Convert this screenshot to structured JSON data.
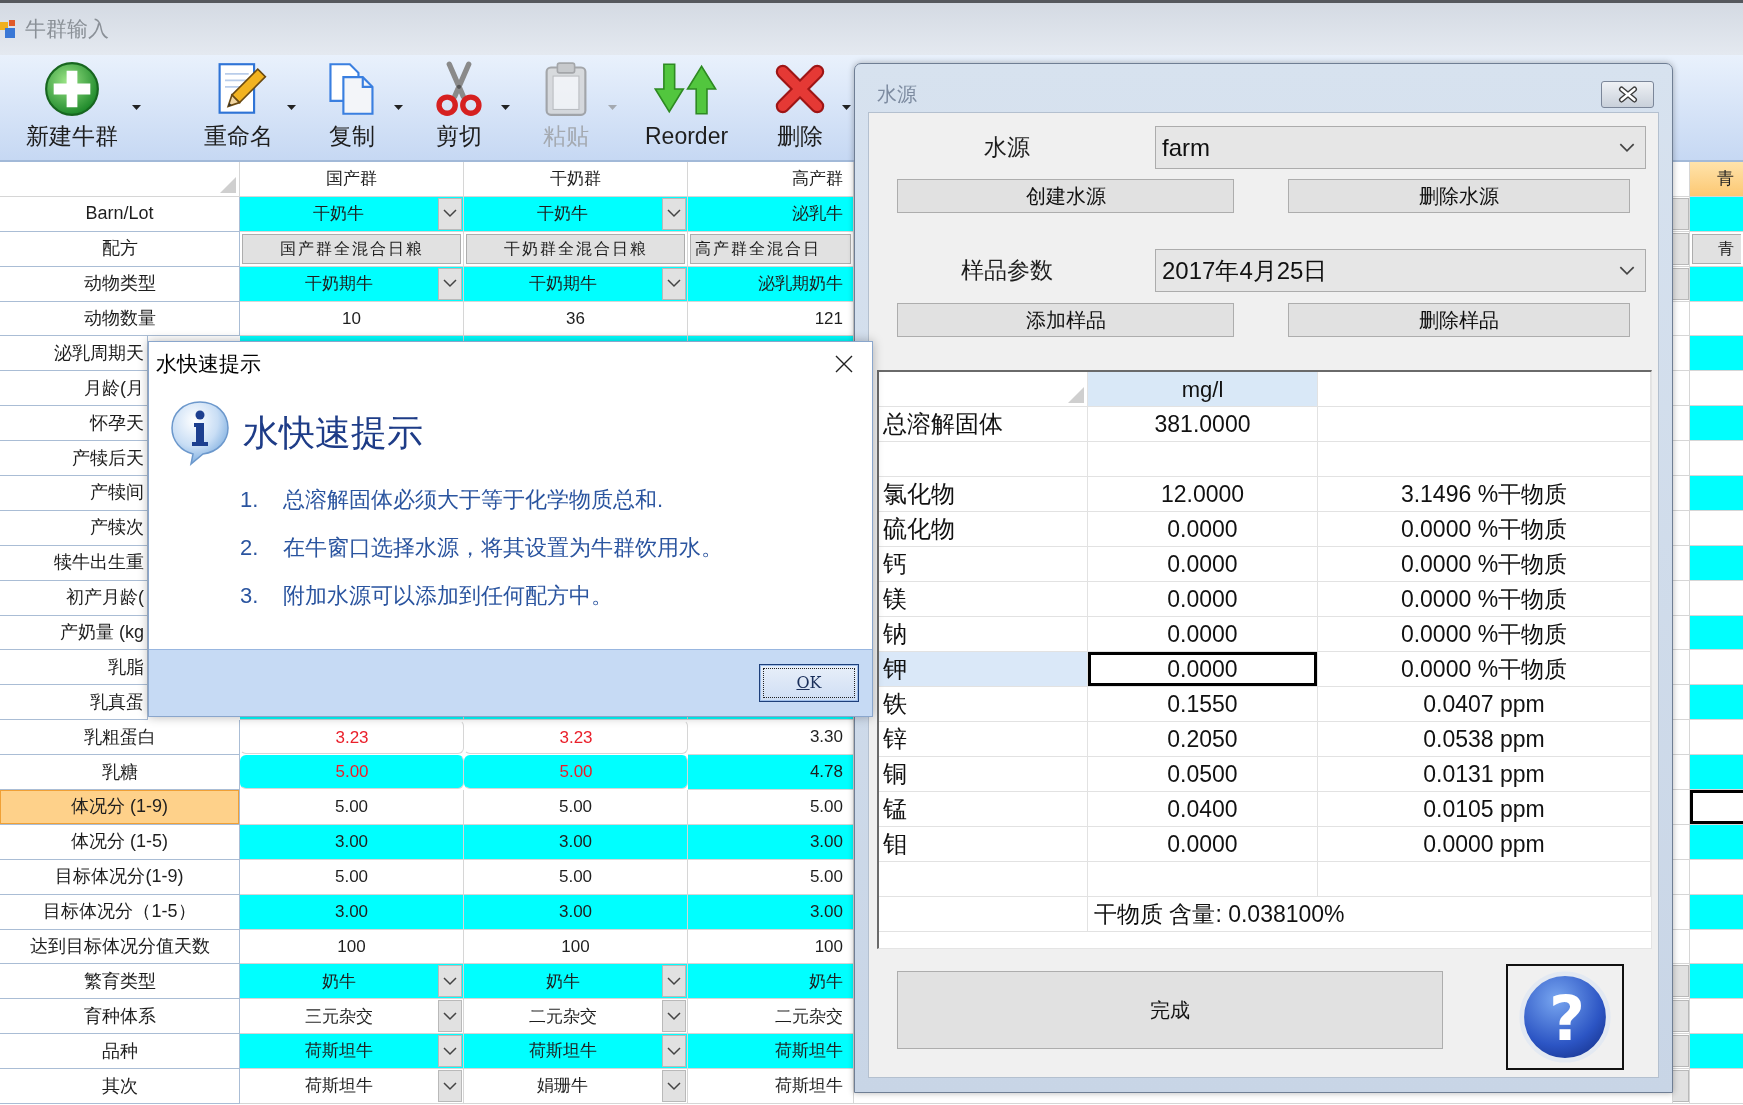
{
  "window": {
    "title": "牛群输入"
  },
  "toolbar": [
    {
      "label": "新建牛群",
      "kind": "add",
      "menu": true,
      "disabled": false
    },
    {
      "label": "重命名",
      "kind": "rename",
      "menu": true,
      "disabled": false
    },
    {
      "label": "复制",
      "kind": "copy",
      "menu": true,
      "disabled": false
    },
    {
      "label": "剪切",
      "kind": "cut",
      "menu": true,
      "disabled": false
    },
    {
      "label": "粘贴",
      "kind": "paste",
      "menu": true,
      "disabled": true
    },
    {
      "label": "Reorder",
      "kind": "reorder",
      "menu": false,
      "disabled": false
    },
    {
      "label": "删除",
      "kind": "delete",
      "menu": true,
      "disabled": false
    }
  ],
  "grid": {
    "columns": [
      {
        "header": "国产群",
        "kind": "full",
        "selected": false
      },
      {
        "header": "干奶群",
        "kind": "full",
        "selected": false
      },
      {
        "header": "高产群",
        "kind": "covered",
        "selected": false
      },
      {
        "header": "青",
        "kind": "edge",
        "selected": true
      }
    ],
    "rows": [
      {
        "label": "Barn/Lot",
        "kind": "combo",
        "highlighted": true,
        "selected": false,
        "cells": [
          {
            "text": "干奶牛"
          },
          {
            "text": "干奶牛"
          },
          {
            "text": "泌乳牛"
          }
        ]
      },
      {
        "label": "配方",
        "kind": "button",
        "highlighted": false,
        "selected": false,
        "cells": [
          {
            "text": "国产群全混合日粮"
          },
          {
            "text": "干奶群全混合日粮"
          },
          {
            "text": "高产群全混合日"
          },
          {
            "text": "青"
          }
        ]
      },
      {
        "label": "动物类型",
        "kind": "combo",
        "highlighted": true,
        "selected": false,
        "cells": [
          {
            "text": "干奶期牛"
          },
          {
            "text": "干奶期牛"
          },
          {
            "text": "泌乳期奶牛"
          }
        ]
      },
      {
        "label": "动物数量",
        "kind": "text",
        "highlighted": false,
        "selected": false,
        "cells": [
          {
            "text": "10"
          },
          {
            "text": "36"
          },
          {
            "text": "121"
          }
        ]
      },
      {
        "label": "泌乳周期天",
        "kind": "text",
        "highlighted": true,
        "selected": false
      },
      {
        "label": "月龄(月",
        "kind": "text",
        "highlighted": false,
        "selected": false
      },
      {
        "label": "怀孕天",
        "kind": "text",
        "highlighted": true,
        "selected": false
      },
      {
        "label": "产犊后天",
        "kind": "text",
        "highlighted": false,
        "selected": false
      },
      {
        "label": "产犊间",
        "kind": "text",
        "highlighted": true,
        "selected": false
      },
      {
        "label": "产犊次",
        "kind": "text",
        "highlighted": false,
        "selected": false
      },
      {
        "label": "犊牛出生重",
        "kind": "text",
        "highlighted": true,
        "selected": false
      },
      {
        "label": "初产月龄(",
        "kind": "text",
        "highlighted": false,
        "selected": false
      },
      {
        "label": "产奶量 (kg",
        "kind": "text",
        "highlighted": true,
        "selected": false
      },
      {
        "label": "乳脂",
        "kind": "text",
        "highlighted": false,
        "selected": false
      },
      {
        "label": "乳真蛋",
        "kind": "text",
        "highlighted": true,
        "selected": false
      },
      {
        "label": "乳粗蛋白",
        "kind": "text",
        "highlighted": false,
        "selected": false,
        "cells": [
          {
            "text": "3.23",
            "alert": true
          },
          {
            "text": "3.23",
            "alert": true
          },
          {
            "text": "3.30",
            "alert": false
          }
        ]
      },
      {
        "label": "乳糖",
        "kind": "text",
        "highlighted": true,
        "selected": false,
        "cells": [
          {
            "text": "5.00",
            "alert": true
          },
          {
            "text": "5.00",
            "alert": true
          },
          {
            "text": "4.78",
            "alert": false
          }
        ]
      },
      {
        "label": "体况分 (1-9)",
        "kind": "text",
        "highlighted": false,
        "selected": true,
        "cells": [
          {
            "text": "5.00"
          },
          {
            "text": "5.00"
          },
          {
            "text": "5.00"
          }
        ]
      },
      {
        "label": "体况分 (1-5)",
        "kind": "text",
        "highlighted": true,
        "selected": false,
        "cells": [
          {
            "text": "3.00"
          },
          {
            "text": "3.00"
          },
          {
            "text": "3.00"
          }
        ]
      },
      {
        "label": "目标体况分(1-9)",
        "kind": "text",
        "highlighted": false,
        "selected": false,
        "cells": [
          {
            "text": "5.00"
          },
          {
            "text": "5.00"
          },
          {
            "text": "5.00"
          }
        ]
      },
      {
        "label": "目标体况分（1-5）",
        "kind": "text",
        "highlighted": true,
        "selected": false,
        "cells": [
          {
            "text": "3.00"
          },
          {
            "text": "3.00"
          },
          {
            "text": "3.00"
          }
        ]
      },
      {
        "label": "达到目标体况分值天数",
        "kind": "text",
        "highlighted": false,
        "selected": false,
        "cells": [
          {
            "text": "100"
          },
          {
            "text": "100"
          },
          {
            "text": "100"
          }
        ]
      },
      {
        "label": "繁育类型",
        "kind": "combo",
        "highlighted": true,
        "selected": false,
        "cells": [
          {
            "text": "奶牛"
          },
          {
            "text": "奶牛"
          },
          {
            "text": "奶牛"
          }
        ]
      },
      {
        "label": "育种体系",
        "kind": "combo",
        "highlighted": false,
        "selected": false,
        "cells": [
          {
            "text": "三元杂交"
          },
          {
            "text": "二元杂交"
          },
          {
            "text": "二元杂交"
          }
        ]
      },
      {
        "label": "品种",
        "kind": "combo",
        "highlighted": true,
        "selected": false,
        "cells": [
          {
            "text": "荷斯坦牛"
          },
          {
            "text": "荷斯坦牛"
          },
          {
            "text": "荷斯坦牛"
          }
        ]
      },
      {
        "label": "其次",
        "kind": "combo",
        "highlighted": false,
        "selected": false,
        "cells": [
          {
            "text": "荷斯坦牛"
          },
          {
            "text": "娟珊牛"
          },
          {
            "text": "荷斯坦牛"
          }
        ]
      }
    ]
  },
  "water_dialog": {
    "title": "水源",
    "source": {
      "label": "水源",
      "value": "farm"
    },
    "source_buttons": [
      "创建水源",
      "删除水源"
    ],
    "sample": {
      "label": "样品参数",
      "value": "2017年4月25日"
    },
    "sample_buttons": [
      "添加样品",
      "删除样品"
    ],
    "table": {
      "columns": [
        {
          "header": "mg/l",
          "selected": true
        },
        {
          "selected": false
        }
      ],
      "rows": [
        {
          "kind": "data",
          "label": "总溶解固体",
          "value": "381.0000",
          "selected": false
        },
        {
          "kind": "blank",
          "selected": false
        },
        {
          "kind": "data",
          "label": "氯化物",
          "value": "12.0000",
          "share": "3.1496 %干物质",
          "selected": false
        },
        {
          "kind": "data",
          "label": "硫化物",
          "value": "0.0000",
          "share": "0.0000 %干物质",
          "selected": false
        },
        {
          "kind": "data",
          "label": "钙",
          "value": "0.0000",
          "share": "0.0000 %干物质",
          "selected": false
        },
        {
          "kind": "data",
          "label": "镁",
          "value": "0.0000",
          "share": "0.0000 %干物质",
          "selected": false
        },
        {
          "kind": "data",
          "label": "钠",
          "value": "0.0000",
          "share": "0.0000 %干物质",
          "selected": false
        },
        {
          "kind": "data",
          "label": "钾",
          "value": "0.0000",
          "share": "0.0000 %干物质",
          "selected": true
        },
        {
          "kind": "data",
          "label": "铁",
          "value": "0.1550",
          "share": "0.0407 ppm",
          "selected": false
        },
        {
          "kind": "data",
          "label": "锌",
          "value": "0.2050",
          "share": "0.0538 ppm",
          "selected": false
        },
        {
          "kind": "data",
          "label": "铜",
          "value": "0.0500",
          "share": "0.0131 ppm",
          "selected": false
        },
        {
          "kind": "data",
          "label": "锰",
          "value": "0.0400",
          "share": "0.0105 ppm",
          "selected": false
        },
        {
          "kind": "data",
          "label": "钼",
          "value": "0.0000",
          "share": "0.0000 ppm",
          "selected": false
        },
        {
          "kind": "blank",
          "selected": false
        },
        {
          "kind": "summary",
          "text": "干物质 含量: 0.038100%",
          "selected": false
        }
      ]
    },
    "done_button": "完成",
    "help_button": "?"
  },
  "tip_dialog": {
    "title": "水快速提示",
    "heading": "水快速提示",
    "items": [
      {
        "number": "1.",
        "text": "总溶解固体必须大于等于化学物质总和."
      },
      {
        "number": "2.",
        "text": "在牛窗口选择水源，将其设置为牛群饮用水。"
      },
      {
        "number": "3.",
        "text": "附加水源可以添加到任何配方中。"
      }
    ],
    "ok_button": "OK"
  }
}
